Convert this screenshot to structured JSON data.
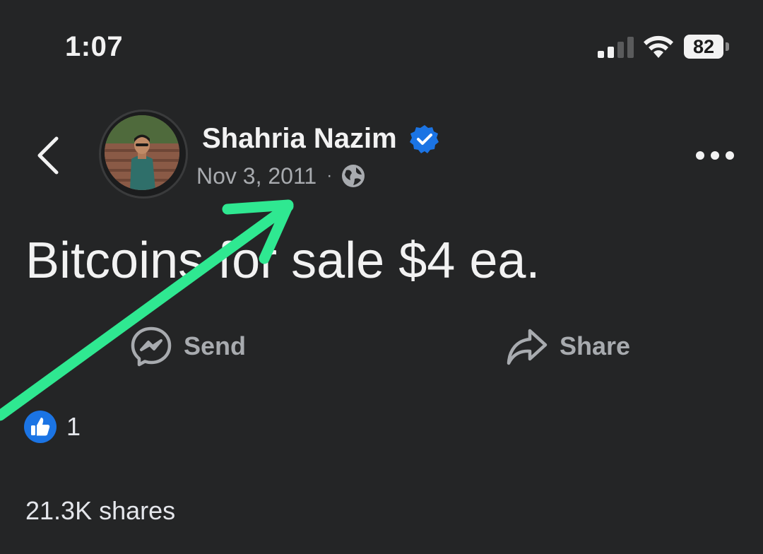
{
  "status_bar": {
    "time": "1:07",
    "battery": "82",
    "icons": [
      "signal-icon",
      "wifi-icon",
      "battery-icon"
    ]
  },
  "post": {
    "author": "Shahria Nazim",
    "verified": true,
    "date": "Nov 3, 2011",
    "separator": "·",
    "audience_icon": "globe-icon",
    "text": "Bitcoins for sale $4 ea."
  },
  "actions": {
    "send_label": "Send",
    "share_label": "Share"
  },
  "reactions": {
    "like_count": "1"
  },
  "shares": {
    "label": "21.3K shares"
  },
  "colors": {
    "background": "#242526",
    "text_primary": "#f2f2f2",
    "text_secondary": "#a8abaf",
    "verified_blue": "#1b74e4",
    "annotation_arrow": "#2fe891"
  }
}
